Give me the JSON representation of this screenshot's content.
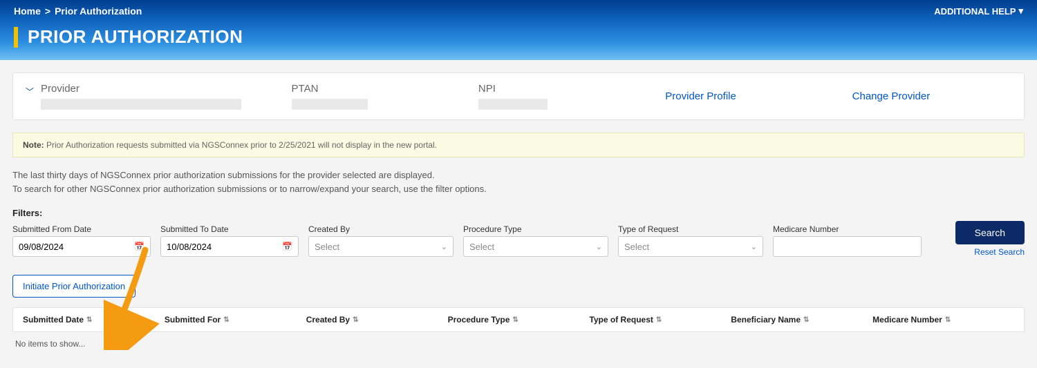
{
  "breadcrumb": {
    "home": "Home",
    "current": "Prior Authorization"
  },
  "header": {
    "additional_help": "ADDITIONAL HELP",
    "page_title": "PRIOR AUTHORIZATION"
  },
  "provider_panel": {
    "provider_label": "Provider",
    "ptan_label": "PTAN",
    "npi_label": "NPI",
    "profile_link": "Provider Profile",
    "change_link": "Change Provider"
  },
  "note": {
    "prefix": "Note:",
    "text": " Prior Authorization requests submitted via NGSConnex prior to 2/25/2021 will not display in the new portal."
  },
  "description": {
    "line1": "The last thirty days of NGSConnex prior authorization submissions for the provider selected are displayed.",
    "line2": "To search for other NGSConnex prior authorization submissions or to narrow/expand your search, use the filter options."
  },
  "filters": {
    "heading": "Filters:",
    "from_label": "Submitted From Date",
    "from_value": "09/08/2024",
    "to_label": "Submitted To Date",
    "to_value": "10/08/2024",
    "created_by_label": "Created By",
    "created_by_value": "Select",
    "procedure_label": "Procedure Type",
    "procedure_value": "Select",
    "request_label": "Type of Request",
    "request_value": "Select",
    "medicare_label": "Medicare Number",
    "medicare_value": "",
    "search_btn": "Search",
    "reset_link": "Reset Search"
  },
  "initiate_btn": "Initiate Prior Authorization",
  "table": {
    "columns": {
      "submitted_date": "Submitted Date",
      "submitted_for": "Submitted For",
      "created_by": "Created By",
      "procedure_type": "Procedure Type",
      "type_of_request": "Type of Request",
      "beneficiary_name": "Beneficiary Name",
      "medicare_number": "Medicare Number"
    },
    "no_items": "No items to show..."
  }
}
